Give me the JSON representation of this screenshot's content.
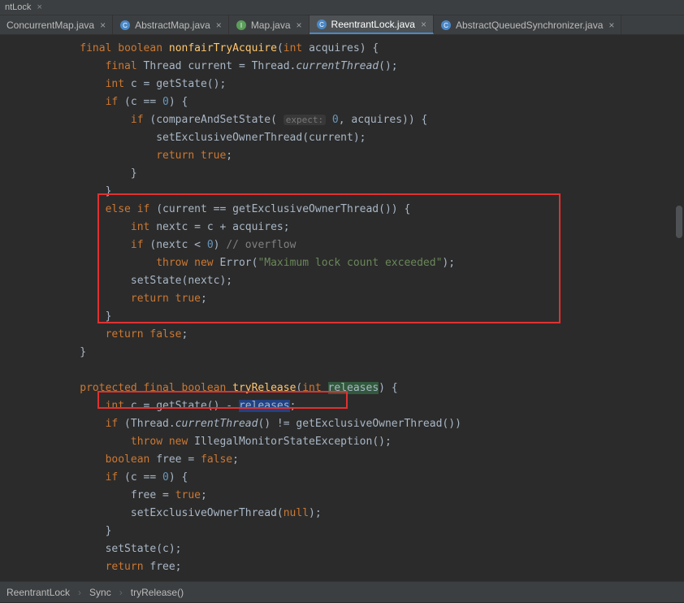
{
  "window": {
    "title_suffix": "ntLock"
  },
  "tabs": [
    {
      "label": "ConcurrentMap.java",
      "icon": "interface",
      "active": false
    },
    {
      "label": "AbstractMap.java",
      "icon": "class",
      "active": false
    },
    {
      "label": "Map.java",
      "icon": "interface",
      "active": false
    },
    {
      "label": "ReentrantLock.java",
      "icon": "class",
      "active": true
    },
    {
      "label": "AbstractQueuedSynchronizer.java",
      "icon": "class",
      "active": false
    }
  ],
  "breadcrumbs": [
    "ReentrantLock",
    "Sync",
    "tryRelease()"
  ],
  "code": {
    "lines": [
      {
        "indent": 2,
        "tokens": [
          [
            "kw",
            "final"
          ],
          [
            "ptext",
            " "
          ],
          [
            "kw",
            "boolean"
          ],
          [
            "ptext",
            " "
          ],
          [
            "method",
            "nonfairTryAcquire"
          ],
          [
            "ptext",
            "("
          ],
          [
            "kw",
            "int"
          ],
          [
            "ptext",
            " acquires) {"
          ]
        ]
      },
      {
        "indent": 3,
        "tokens": [
          [
            "kw",
            "final"
          ],
          [
            "ptext",
            " Thread current = Thread."
          ],
          [
            "italic",
            "currentThread"
          ],
          [
            "ptext",
            "();"
          ]
        ]
      },
      {
        "indent": 3,
        "tokens": [
          [
            "kw",
            "int"
          ],
          [
            "ptext",
            " c = getState();"
          ]
        ]
      },
      {
        "indent": 3,
        "tokens": [
          [
            "kw",
            "if"
          ],
          [
            "ptext",
            " (c == "
          ],
          [
            "num",
            "0"
          ],
          [
            "ptext",
            ") {"
          ]
        ]
      },
      {
        "indent": 4,
        "tokens": [
          [
            "kw",
            "if"
          ],
          [
            "ptext",
            " (compareAndSetState( "
          ],
          [
            "hint",
            "expect:"
          ],
          [
            "ptext",
            " "
          ],
          [
            "num",
            "0"
          ],
          [
            "ptext",
            ", acquires)) {"
          ]
        ]
      },
      {
        "indent": 5,
        "tokens": [
          [
            "ptext",
            "setExclusiveOwnerThread(current);"
          ]
        ]
      },
      {
        "indent": 5,
        "tokens": [
          [
            "kw",
            "return true"
          ],
          [
            "ptext",
            ";"
          ]
        ]
      },
      {
        "indent": 4,
        "tokens": [
          [
            "ptext",
            "}"
          ]
        ]
      },
      {
        "indent": 3,
        "tokens": [
          [
            "ptext",
            "}"
          ]
        ]
      },
      {
        "indent": 3,
        "tokens": [
          [
            "kw",
            "else if"
          ],
          [
            "ptext",
            " (current == getExclusiveOwnerThread()) {"
          ]
        ]
      },
      {
        "indent": 4,
        "tokens": [
          [
            "kw",
            "int"
          ],
          [
            "ptext",
            " nextc = c + acquires;"
          ]
        ]
      },
      {
        "indent": 4,
        "tokens": [
          [
            "kw",
            "if"
          ],
          [
            "ptext",
            " (nextc < "
          ],
          [
            "num",
            "0"
          ],
          [
            "ptext",
            ") "
          ],
          [
            "comm",
            "// overflow"
          ]
        ]
      },
      {
        "indent": 5,
        "tokens": [
          [
            "kw",
            "throw new"
          ],
          [
            "ptext",
            " Error("
          ],
          [
            "str",
            "\"Maximum lock count exceeded\""
          ],
          [
            "ptext",
            ");"
          ]
        ]
      },
      {
        "indent": 4,
        "tokens": [
          [
            "ptext",
            "setState(nextc);"
          ]
        ]
      },
      {
        "indent": 4,
        "tokens": [
          [
            "kw",
            "return true"
          ],
          [
            "ptext",
            ";"
          ]
        ]
      },
      {
        "indent": 3,
        "tokens": [
          [
            "ptext",
            "}"
          ]
        ]
      },
      {
        "indent": 3,
        "tokens": [
          [
            "kw",
            "return false"
          ],
          [
            "ptext",
            ";"
          ]
        ]
      },
      {
        "indent": 2,
        "tokens": [
          [
            "ptext",
            "}"
          ]
        ]
      },
      {
        "indent": 0,
        "tokens": [
          [
            "ptext",
            ""
          ]
        ]
      },
      {
        "indent": 2,
        "tokens": [
          [
            "kw",
            "protected final boolean"
          ],
          [
            "ptext",
            " "
          ],
          [
            "method",
            "tryRelease"
          ],
          [
            "ptext",
            "("
          ],
          [
            "kw",
            "int"
          ],
          [
            "ptext",
            " "
          ],
          [
            "sel_param",
            "releases"
          ],
          [
            "ptext",
            ") {"
          ]
        ]
      },
      {
        "indent": 3,
        "tokens": [
          [
            "kw",
            "int"
          ],
          [
            "ptext",
            " c = getState() - "
          ],
          [
            "sel",
            "releases"
          ],
          [
            "ptext",
            ";"
          ]
        ]
      },
      {
        "indent": 3,
        "tokens": [
          [
            "kw",
            "if"
          ],
          [
            "ptext",
            " (Thread."
          ],
          [
            "italic",
            "currentThread"
          ],
          [
            "ptext",
            "() != getExclusiveOwnerThread())"
          ]
        ]
      },
      {
        "indent": 4,
        "tokens": [
          [
            "kw",
            "throw new"
          ],
          [
            "ptext",
            " IllegalMonitorStateException();"
          ]
        ]
      },
      {
        "indent": 3,
        "tokens": [
          [
            "kw",
            "boolean"
          ],
          [
            "ptext",
            " free = "
          ],
          [
            "kw",
            "false"
          ],
          [
            "ptext",
            ";"
          ]
        ]
      },
      {
        "indent": 3,
        "tokens": [
          [
            "kw",
            "if"
          ],
          [
            "ptext",
            " (c == "
          ],
          [
            "num",
            "0"
          ],
          [
            "ptext",
            ") {"
          ]
        ]
      },
      {
        "indent": 4,
        "tokens": [
          [
            "ptext",
            "free = "
          ],
          [
            "kw",
            "true"
          ],
          [
            "ptext",
            ";"
          ]
        ]
      },
      {
        "indent": 4,
        "tokens": [
          [
            "ptext",
            "setExclusiveOwnerThread("
          ],
          [
            "kw",
            "null"
          ],
          [
            "ptext",
            ");"
          ]
        ]
      },
      {
        "indent": 3,
        "tokens": [
          [
            "ptext",
            "}"
          ]
        ]
      },
      {
        "indent": 3,
        "tokens": [
          [
            "ptext",
            "setState(c);"
          ]
        ]
      },
      {
        "indent": 3,
        "tokens": [
          [
            "kw",
            "return"
          ],
          [
            "ptext",
            " free;"
          ]
        ]
      }
    ]
  }
}
